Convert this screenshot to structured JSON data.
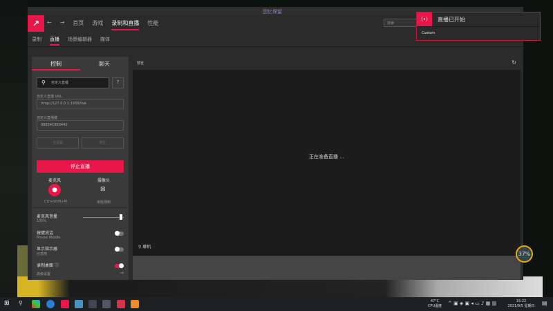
{
  "window": {
    "title": "回忆保留",
    "search_placeholder": "搜索"
  },
  "nav": {
    "items": [
      "首页",
      "游戏",
      "录制和直播",
      "性能"
    ],
    "active": "录制和直播"
  },
  "subnav": {
    "items": [
      "录制",
      "直播",
      "场景编辑器",
      "媒体"
    ],
    "active": "直播"
  },
  "panel": {
    "tabs": [
      "控制",
      "聊天"
    ],
    "service": "自定义直播",
    "url_label": "自定义直播 URL",
    "url_value": "rtmp://127.0.0.1:1935/live",
    "key_label": "自定义直播键",
    "key_value": "00E04C850442",
    "btn_fullscreen": "全屏幕",
    "btn_region": "地区",
    "stop_label": "停止直播",
    "mic_label": "麦克风",
    "mic_shortcut": "Ctrl+Shift+M",
    "cam_label": "摄像头",
    "cam_status": "未检测到",
    "volume_label": "麦克风音量",
    "volume_value": "100%",
    "volume_percent": 100,
    "ptt_label": "按键说话",
    "ptt_value": "Mouse Middle",
    "indicator_label": "显示指示器",
    "indicator_value": "已禁用",
    "desktop_label": "录制桌面",
    "advanced": "高级设置"
  },
  "preview": {
    "title": "预览",
    "status": "正在准备直播 ...",
    "viewer_label": "聊机"
  },
  "toast": {
    "title": "直播已开始",
    "body": "Custom"
  },
  "overlay": {
    "percent": "37%"
  },
  "taskbar": {
    "temp": "47°C",
    "temp_label": "CPU温度",
    "time": "15:22",
    "date": "2021/9/5 星期日"
  },
  "colors": {
    "accent": "#e8174a"
  }
}
